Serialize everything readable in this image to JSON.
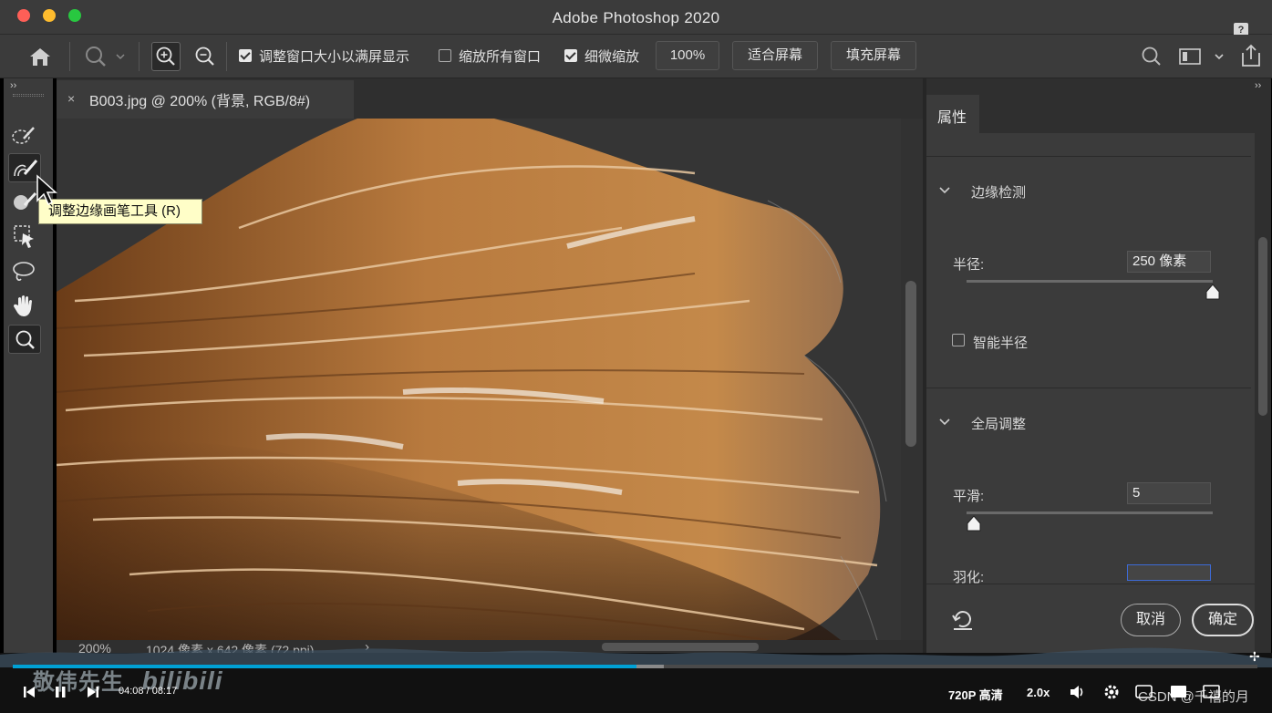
{
  "window": {
    "title": "Adobe Photoshop 2020",
    "help": "?"
  },
  "options": {
    "fit_window_label": "调整窗口大小以满屏显示",
    "zoom_all_label": "缩放所有窗口",
    "scrubby_label": "细微缩放",
    "zoom_value": "100%",
    "fit_screen": "适合屏幕",
    "fill_screen": "填充屏幕"
  },
  "document": {
    "tab_title": "B003.jpg @ 200% (背景, RGB/8#)",
    "close": "×",
    "status_zoom": "200%",
    "status_dims": "1024 像素 x 642 像素 (72 ppi)",
    "status_arrow": "›"
  },
  "tooltip": {
    "text": "调整边缘画笔工具 (R)"
  },
  "properties": {
    "tab": "属性",
    "edge_section": "边缘检测",
    "radius_label": "半径:",
    "radius_value": "250 像素",
    "radius_fraction": 1.0,
    "smart_radius": "智能半径",
    "global_section": "全局调整",
    "smooth_label": "平滑:",
    "smooth_value": "5",
    "smooth_fraction": 0.03,
    "feather_label": "羽化:",
    "cancel": "取消",
    "ok": "确定"
  },
  "player": {
    "time": "04:08 / 08:17",
    "quality": "720P 高清",
    "speed": "2.0x",
    "watermark": "敬伟先生",
    "watermark_logo": "bilibili",
    "credit": "CSDN @千禧的月",
    "progress": 0.501
  },
  "colors": {
    "accent": "#00a1d6",
    "panel": "#3b3b3b",
    "tooltip": "#fffec8"
  }
}
